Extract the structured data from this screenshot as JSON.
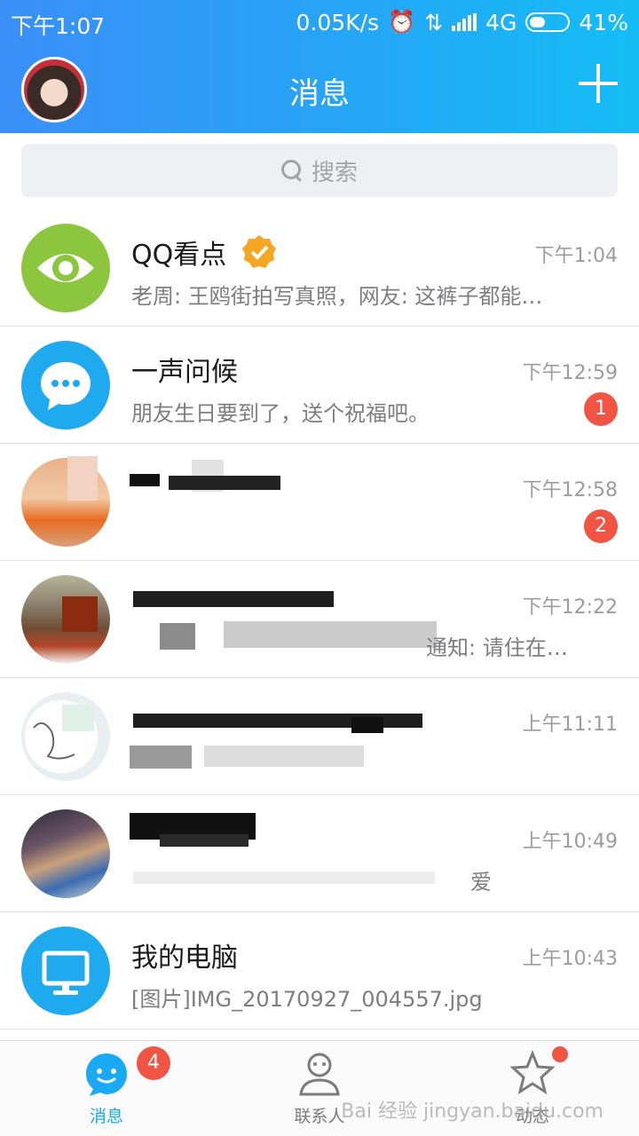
{
  "status_bar": {
    "time": "下午1:07",
    "speed": "0.05K/s",
    "network": "4G",
    "battery": "41%"
  },
  "nav": {
    "title": "消息"
  },
  "search": {
    "placeholder": "搜索"
  },
  "conversations": [
    {
      "name": "QQ看点",
      "message": "老周: 王鸥街拍写真照，网友: 这裤子都能…",
      "time": "下午1:04",
      "badge": ""
    },
    {
      "name": "一声问候",
      "message": "朋友生日要到了，送个祝福吧。",
      "time": "下午12:59",
      "badge": "1"
    },
    {
      "name": "",
      "message": "",
      "time": "下午12:58",
      "badge": "2"
    },
    {
      "name": "",
      "message": "通知: 请住在…",
      "time": "下午12:22",
      "badge": ""
    },
    {
      "name": "",
      "message": "",
      "time": "上午11:11",
      "badge": ""
    },
    {
      "name": "",
      "message": "爱",
      "time": "上午10:49",
      "badge": ""
    },
    {
      "name": "我的电脑",
      "message": "[图片]IMG_20170927_004557.jpg",
      "time": "上午10:43",
      "badge": ""
    }
  ],
  "tabbar": {
    "messages": "消息",
    "messages_badge": "4",
    "contacts": "联系人",
    "moments": "动态"
  },
  "watermark": "Bai 经验 jingyan.baidu.com",
  "colors": {
    "header_start": "#3a8ff7",
    "header_end": "#14bdf6",
    "badge": "#f25443",
    "accent": "#19a9f5"
  }
}
